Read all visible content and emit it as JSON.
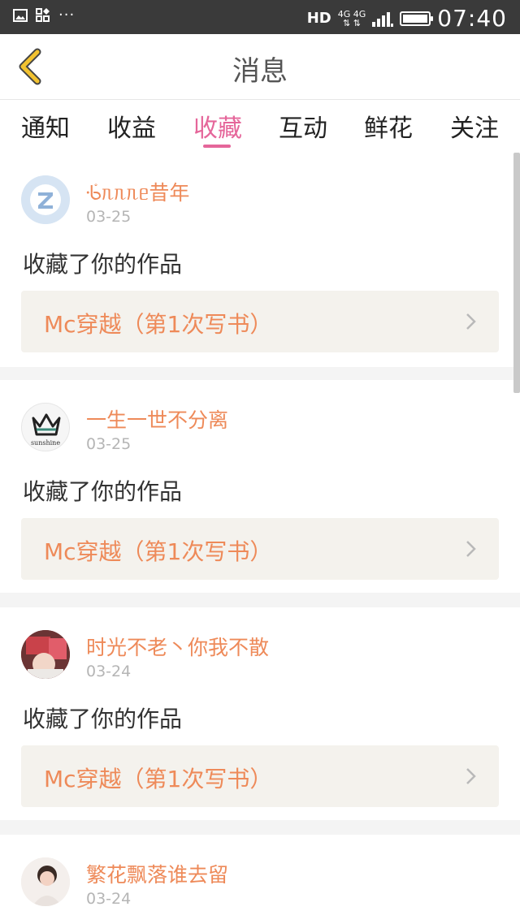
{
  "status_bar": {
    "hd": "HD",
    "net_top": "4G 4G",
    "net_bottom": "⇅ ⇅",
    "time": "07:40",
    "dots": "···"
  },
  "header": {
    "title": "消息",
    "back_icon": "chevron-left-icon"
  },
  "tabs": [
    {
      "label": "通知",
      "active": false
    },
    {
      "label": "收益",
      "active": false
    },
    {
      "label": "收藏",
      "active": true
    },
    {
      "label": "互动",
      "active": false
    },
    {
      "label": "鲜花",
      "active": false
    },
    {
      "label": "关注",
      "active": false
    }
  ],
  "messages": [
    {
      "username": "ᢹᥰᥰᥰᥱ昔年",
      "date": "03-25",
      "action": "收藏了你的作品",
      "work_title": "Mc穿越（第1次写书）"
    },
    {
      "username": "一生一世不分离",
      "date": "03-25",
      "action": "收藏了你的作品",
      "work_title": "Mc穿越（第1次写书）",
      "avatar_text": "sunshine"
    },
    {
      "username": "时光不老丶你我不散",
      "date": "03-24",
      "action": "收藏了你的作品",
      "work_title": "Mc穿越（第1次写书）"
    },
    {
      "username": "繁花飘落谁去留",
      "date": "03-24",
      "action": "",
      "work_title": ""
    }
  ],
  "colors": {
    "accent_pink": "#e5669a",
    "accent_orange": "#ee8a59",
    "back_icon": "#f2c230"
  }
}
